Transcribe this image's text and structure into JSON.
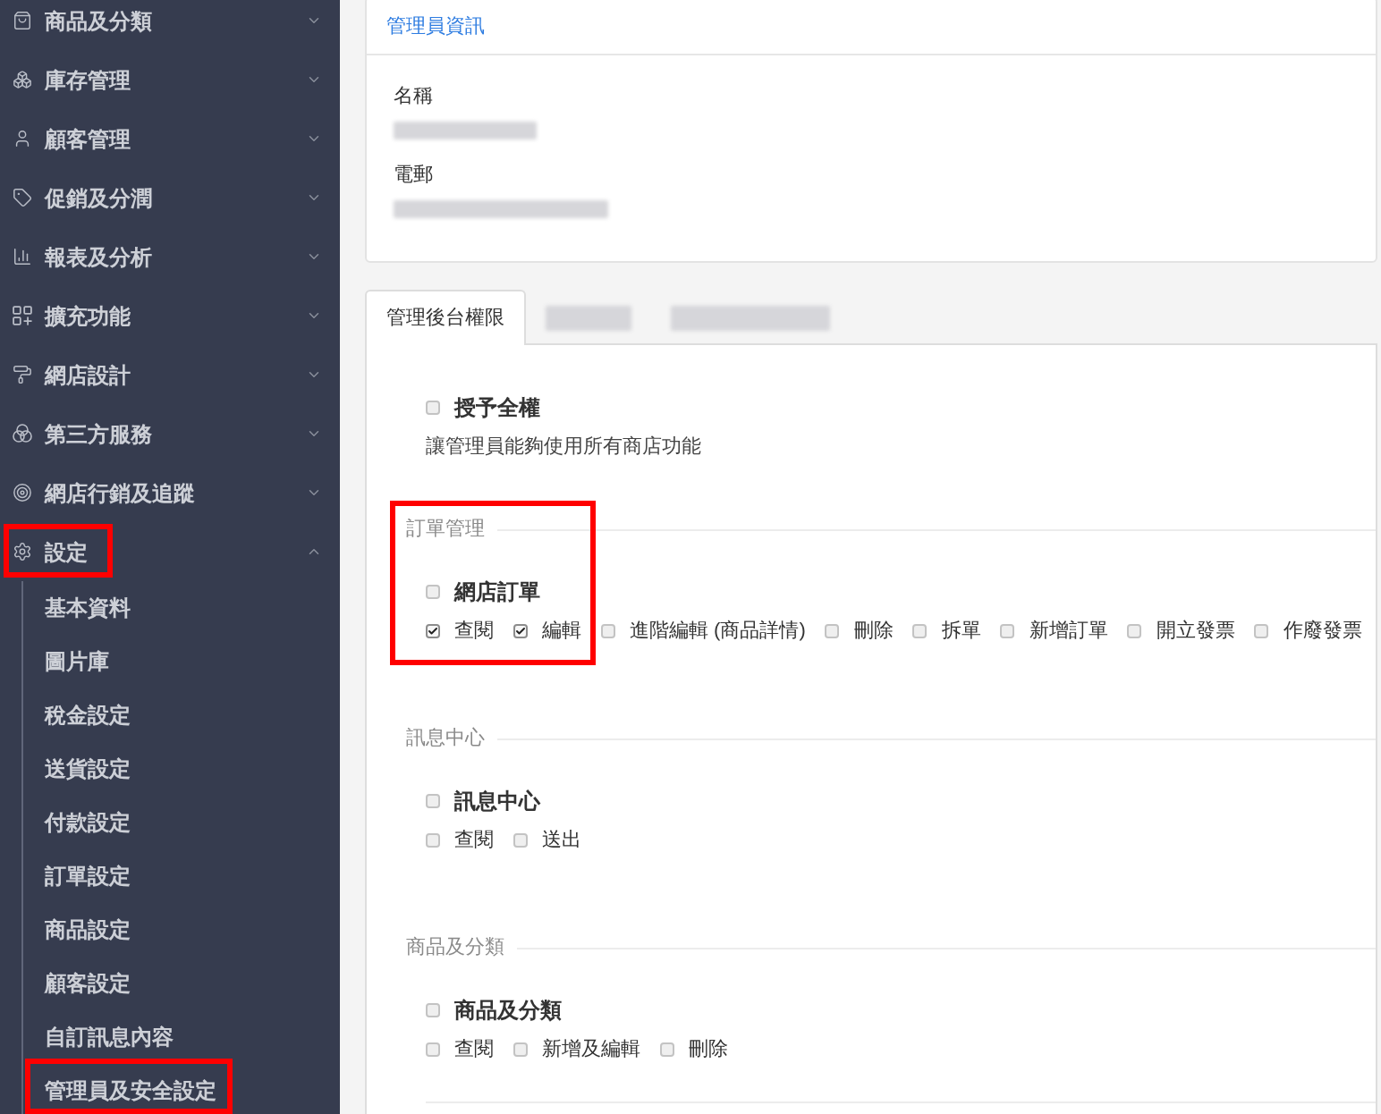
{
  "sidebar": {
    "items": [
      {
        "label": "商品及分類",
        "expanded": false,
        "highlighted": false
      },
      {
        "label": "庫存管理",
        "expanded": false,
        "highlighted": false
      },
      {
        "label": "顧客管理",
        "expanded": false,
        "highlighted": false
      },
      {
        "label": "促銷及分潤",
        "expanded": false,
        "highlighted": false
      },
      {
        "label": "報表及分析",
        "expanded": false,
        "highlighted": false
      },
      {
        "label": "擴充功能",
        "expanded": false,
        "highlighted": false
      },
      {
        "label": "網店設計",
        "expanded": false,
        "highlighted": false
      },
      {
        "label": "第三方服務",
        "expanded": false,
        "highlighted": false
      },
      {
        "label": "網店行銷及追蹤",
        "expanded": false,
        "highlighted": false
      },
      {
        "label": "設定",
        "expanded": true,
        "highlighted": true,
        "children": [
          {
            "label": "基本資料",
            "highlighted": false
          },
          {
            "label": "圖片庫",
            "highlighted": false
          },
          {
            "label": "稅金設定",
            "highlighted": false
          },
          {
            "label": "送貨設定",
            "highlighted": false
          },
          {
            "label": "付款設定",
            "highlighted": false
          },
          {
            "label": "訂單設定",
            "highlighted": false
          },
          {
            "label": "商品設定",
            "highlighted": false
          },
          {
            "label": "顧客設定",
            "highlighted": false
          },
          {
            "label": "自訂訊息內容",
            "highlighted": false
          },
          {
            "label": "管理員及安全設定",
            "highlighted": true
          }
        ]
      }
    ]
  },
  "admin_info": {
    "title": "管理員資訊",
    "fields": [
      {
        "label": "名稱",
        "redacted": true
      },
      {
        "label": "電郵",
        "redacted": true
      }
    ]
  },
  "tabs": [
    {
      "label": "管理後台權限",
      "selected": true,
      "redacted": false
    },
    {
      "selected": false,
      "redacted": true
    },
    {
      "selected": false,
      "redacted": true
    }
  ],
  "full_access": {
    "label": "授予全權",
    "checked": false,
    "description": "讓管理員能夠使用所有商店功能"
  },
  "sections": [
    {
      "title": "訂單管理",
      "highlighted": true,
      "master": {
        "label": "網店訂單",
        "checked": false
      },
      "permissions": [
        {
          "label": "查閱",
          "checked": true
        },
        {
          "label": "編輯",
          "checked": true
        },
        {
          "label": "進階編輯 (商品詳情)",
          "checked": false
        },
        {
          "label": "刪除",
          "checked": false
        },
        {
          "label": "拆單",
          "checked": false
        },
        {
          "label": "新增訂單",
          "checked": false
        },
        {
          "label": "開立發票",
          "checked": false
        },
        {
          "label": "作廢發票",
          "checked": false
        }
      ]
    },
    {
      "title": "訊息中心",
      "highlighted": false,
      "master": {
        "label": "訊息中心",
        "checked": false
      },
      "permissions": [
        {
          "label": "查閱",
          "checked": false
        },
        {
          "label": "送出",
          "checked": false
        }
      ]
    },
    {
      "title": "商品及分類",
      "highlighted": false,
      "master": {
        "label": "商品及分類",
        "checked": false
      },
      "permissions": [
        {
          "label": "查閱",
          "checked": false
        },
        {
          "label": "新增及編輯",
          "checked": false
        },
        {
          "label": "刪除",
          "checked": false
        }
      ]
    }
  ]
}
